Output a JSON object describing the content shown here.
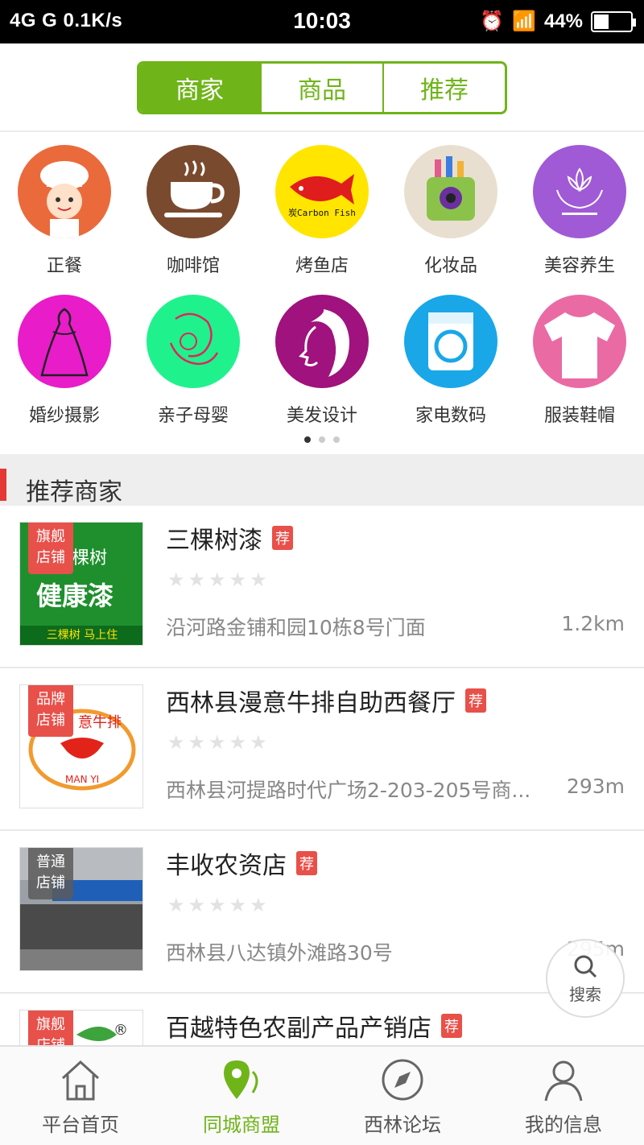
{
  "status": {
    "left": "4G   G   0.1K/s",
    "time": "10:03",
    "battery": "44%"
  },
  "top_tabs": [
    {
      "label": "商家",
      "active": true
    },
    {
      "label": "商品",
      "active": false
    },
    {
      "label": "推荐",
      "active": false
    }
  ],
  "categories": [
    {
      "label": "正餐",
      "icon": "chef-icon",
      "color": "#ea6a3c"
    },
    {
      "label": "咖啡馆",
      "icon": "coffee-cup-icon",
      "color": "#7a4a2e"
    },
    {
      "label": "烤鱼店",
      "icon": "fish-logo-icon",
      "color": "#ffe500",
      "logo_text": "炭Carbon Fish"
    },
    {
      "label": "化妆品",
      "icon": "cosmetics-bag-icon",
      "color": "#e9dfd0"
    },
    {
      "label": "美容养生",
      "icon": "lotus-hands-icon",
      "color": "#a05ad6"
    },
    {
      "label": "婚纱摄影",
      "icon": "wedding-couple-icon",
      "color": "#e81cc9"
    },
    {
      "label": "亲子母婴",
      "icon": "mother-baby-icon",
      "color": "#1ff28c"
    },
    {
      "label": "美发设计",
      "icon": "hair-woman-icon",
      "color": "#a0127d"
    },
    {
      "label": "家电数码",
      "icon": "washing-machine-icon",
      "color": "#19a7e8"
    },
    {
      "label": "服装鞋帽",
      "icon": "tshirt-icon",
      "color": "#ea6aa4"
    }
  ],
  "page_dots": {
    "count": 3,
    "active": 0
  },
  "section_title": "推荐商家",
  "shops": [
    {
      "name": "三棵树漆",
      "tag": "荐",
      "badge_top": "旗舰",
      "badge_bottom": "店铺",
      "badge_style": "red",
      "thumb_text_1": "棵树",
      "thumb_text_2": "健康漆",
      "thumb_text_3": "三棵树 马上住",
      "address": "沿河路金铺和园10栋8号门面",
      "distance": "1.2km"
    },
    {
      "name": "西林县漫意牛排自助西餐厅",
      "tag": "荐",
      "badge_top": "品牌",
      "badge_bottom": "店铺",
      "badge_style": "red",
      "thumb_text_1": "意牛排",
      "thumb_text_2": "MAN YI",
      "thumb_text_3": "",
      "address": "西林县河提路时代广场2-203-205号商...",
      "distance": "293m"
    },
    {
      "name": "丰收农资店",
      "tag": "荐",
      "badge_top": "普通",
      "badge_bottom": "店铺",
      "badge_style": "gray",
      "thumb_text_1": "",
      "thumb_text_2": "",
      "thumb_text_3": "",
      "address": "西林县八达镇外滩路30号",
      "distance": "295m"
    },
    {
      "name": "百越特色农副产品产销店",
      "tag": "荐",
      "badge_top": "旗舰",
      "badge_bottom": "店铺",
      "badge_style": "red",
      "thumb_text_1": "®",
      "thumb_text_2": "",
      "thumb_text_3": "",
      "address": "",
      "distance": ""
    }
  ],
  "stars": "★★★★★",
  "search_fab": {
    "label": "搜索"
  },
  "bottom_nav": [
    {
      "label": "平台首页",
      "icon": "home-icon",
      "active": false
    },
    {
      "label": "同城商盟",
      "icon": "location-pin-icon",
      "active": true
    },
    {
      "label": "西林论坛",
      "icon": "compass-icon",
      "active": false
    },
    {
      "label": "我的信息",
      "icon": "user-icon",
      "active": false
    }
  ]
}
